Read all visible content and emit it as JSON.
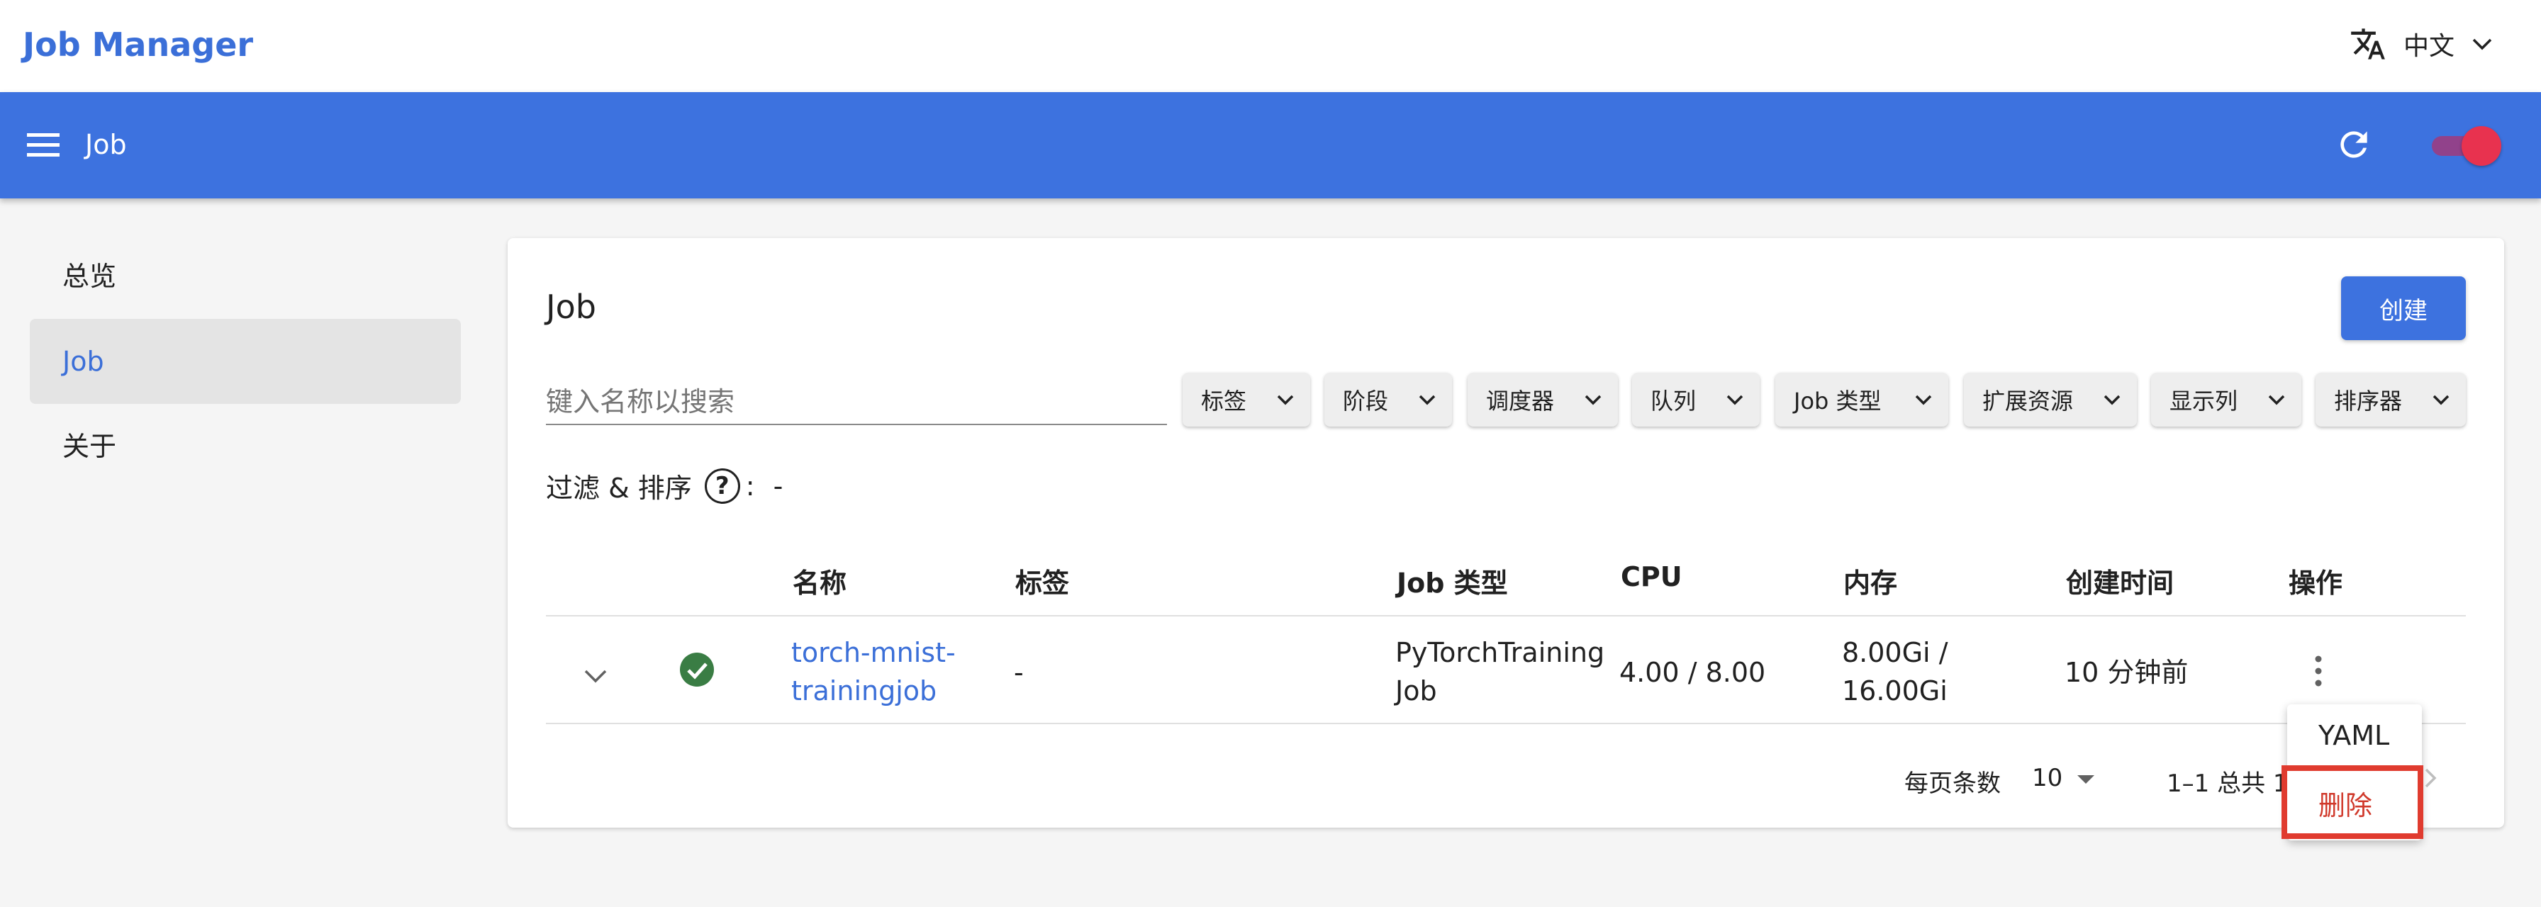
{
  "brand": "Job Manager",
  "language": {
    "label": "中文",
    "icon": "translate-icon"
  },
  "appbar": {
    "title": "Job",
    "menu_icon": "hamburger-menu-icon",
    "refresh_icon": "refresh-icon",
    "theme_toggle": "on"
  },
  "sidebar": {
    "items": [
      {
        "label": "总览"
      },
      {
        "label": "Job",
        "active": true
      },
      {
        "label": "关于"
      }
    ]
  },
  "card": {
    "title": "Job",
    "create_label": "创建",
    "search_placeholder": "键入名称以搜索",
    "filters": [
      "标签",
      "阶段",
      "调度器",
      "队列",
      "Job 类型",
      "扩展资源",
      "显示列",
      "排序器"
    ],
    "filter_sort_label": "过滤 & 排序",
    "filter_sort_value": "-"
  },
  "table": {
    "headers": [
      "名称",
      "标签",
      "Job 类型",
      "CPU",
      "内存",
      "创建时间",
      "操作"
    ],
    "rows": [
      {
        "name_line1": "torch-mnist-",
        "name_line2": "trainingjob",
        "labels": "-",
        "type_line1": "PyTorchTraining",
        "type_line2": "Job",
        "cpu": "4.00 / 8.00",
        "memory_line1": "8.00Gi /",
        "memory_line2": "16.00Gi",
        "created": "10 分钟前",
        "status": "succeeded"
      }
    ]
  },
  "pagination": {
    "rows_per_page_label": "每页条数",
    "rows_per_page": "10",
    "range": "1–1 总共 1"
  },
  "row_menu": {
    "items": [
      "YAML",
      "删除"
    ]
  },
  "colors": {
    "primary": "#3d72df",
    "brand": "#3b6fd8",
    "success": "#3a7d44",
    "danger": "#d0392b",
    "highlight": "#e03b2f"
  }
}
